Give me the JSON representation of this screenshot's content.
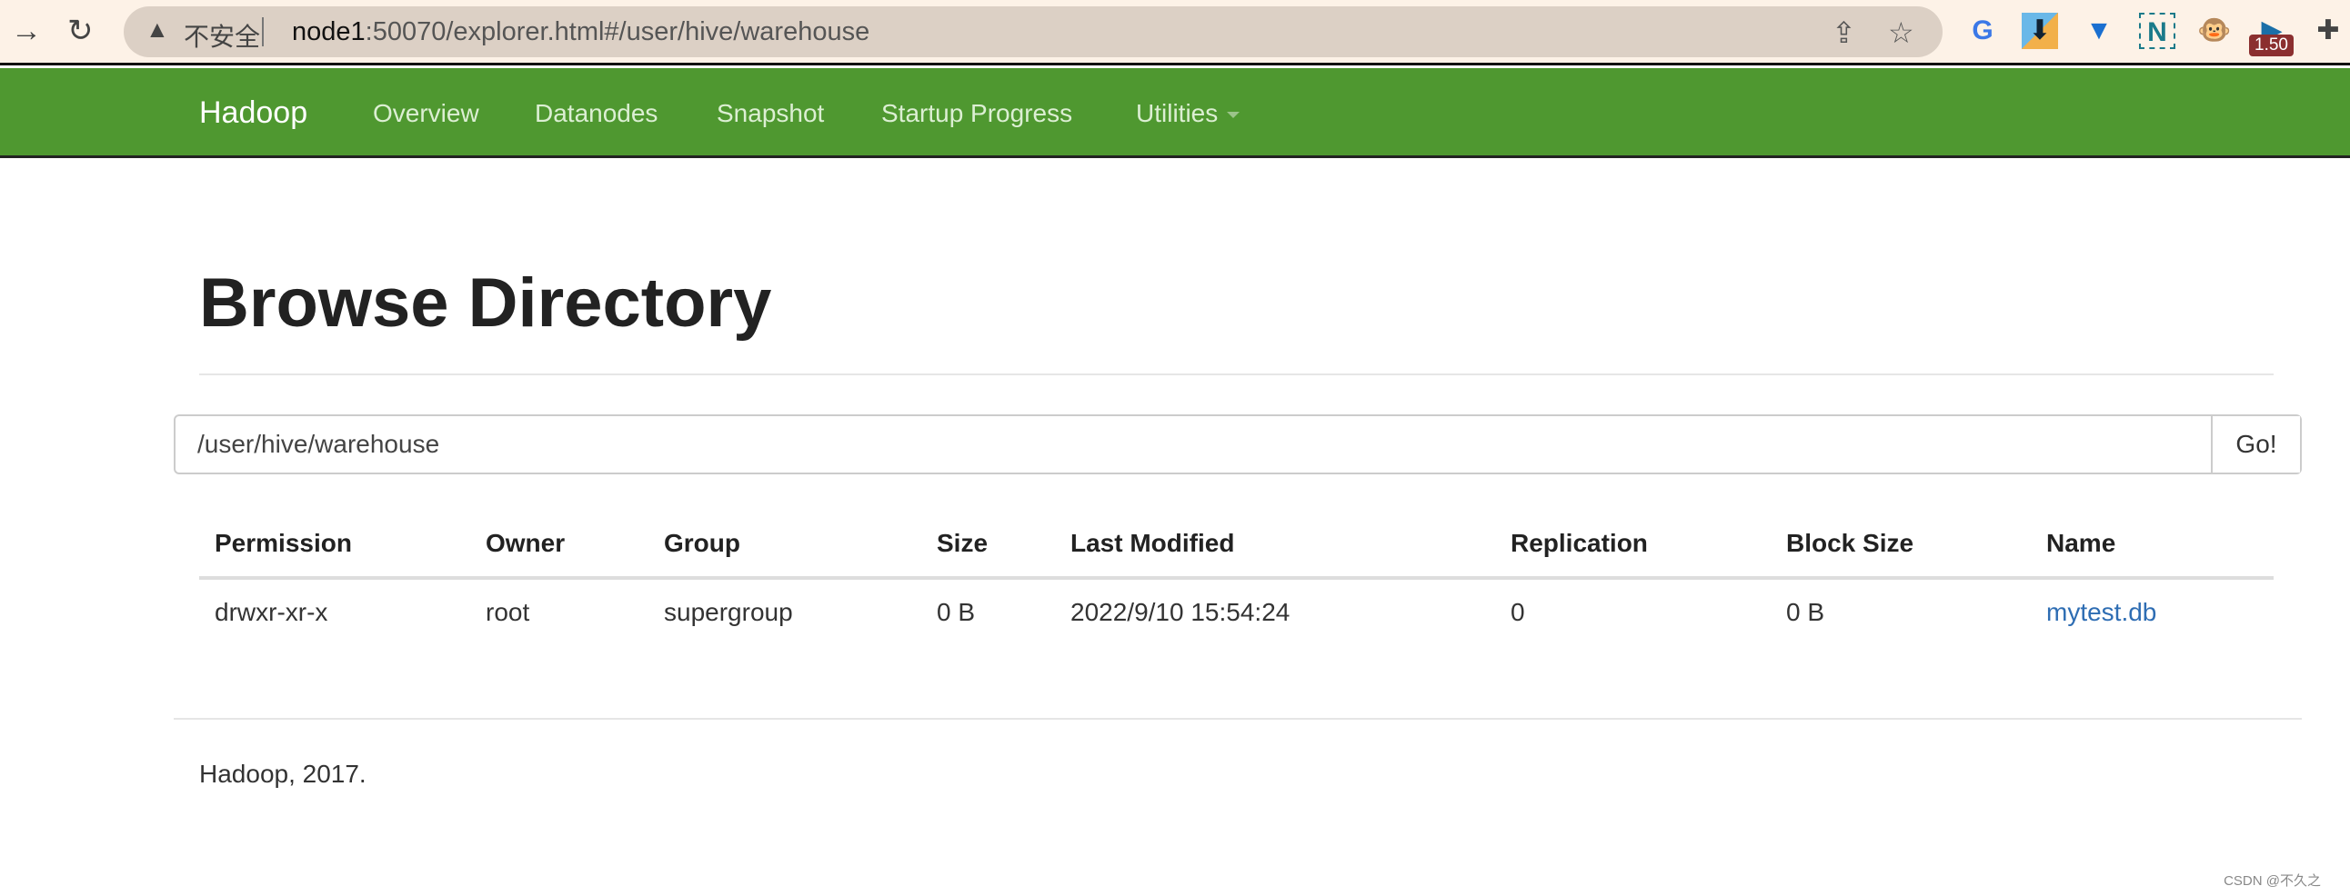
{
  "browser": {
    "insecure_label": "不安全",
    "url_host": "node1",
    "url_rest": ":50070/explorer.html#/user/hive/warehouse",
    "extension_badge": "1.50"
  },
  "navbar": {
    "brand": "Hadoop",
    "items": [
      "Overview",
      "Datanodes",
      "Snapshot",
      "Startup Progress",
      "Utilities"
    ]
  },
  "page": {
    "title": "Browse Directory",
    "path_value": "/user/hive/warehouse",
    "go_label": "Go!"
  },
  "table": {
    "headers": [
      "Permission",
      "Owner",
      "Group",
      "Size",
      "Last Modified",
      "Replication",
      "Block Size",
      "Name"
    ],
    "rows": [
      [
        "drwxr-xr-x",
        "root",
        "supergroup",
        "0 B",
        "2022/9/10 15:54:24",
        "0",
        "0 B",
        "mytest.db"
      ]
    ]
  },
  "footer": {
    "text": "Hadoop, 2017."
  },
  "watermark": "CSDN @不久之",
  "colors": {
    "navbar": "#4f9830",
    "link": "#2e6db3"
  }
}
